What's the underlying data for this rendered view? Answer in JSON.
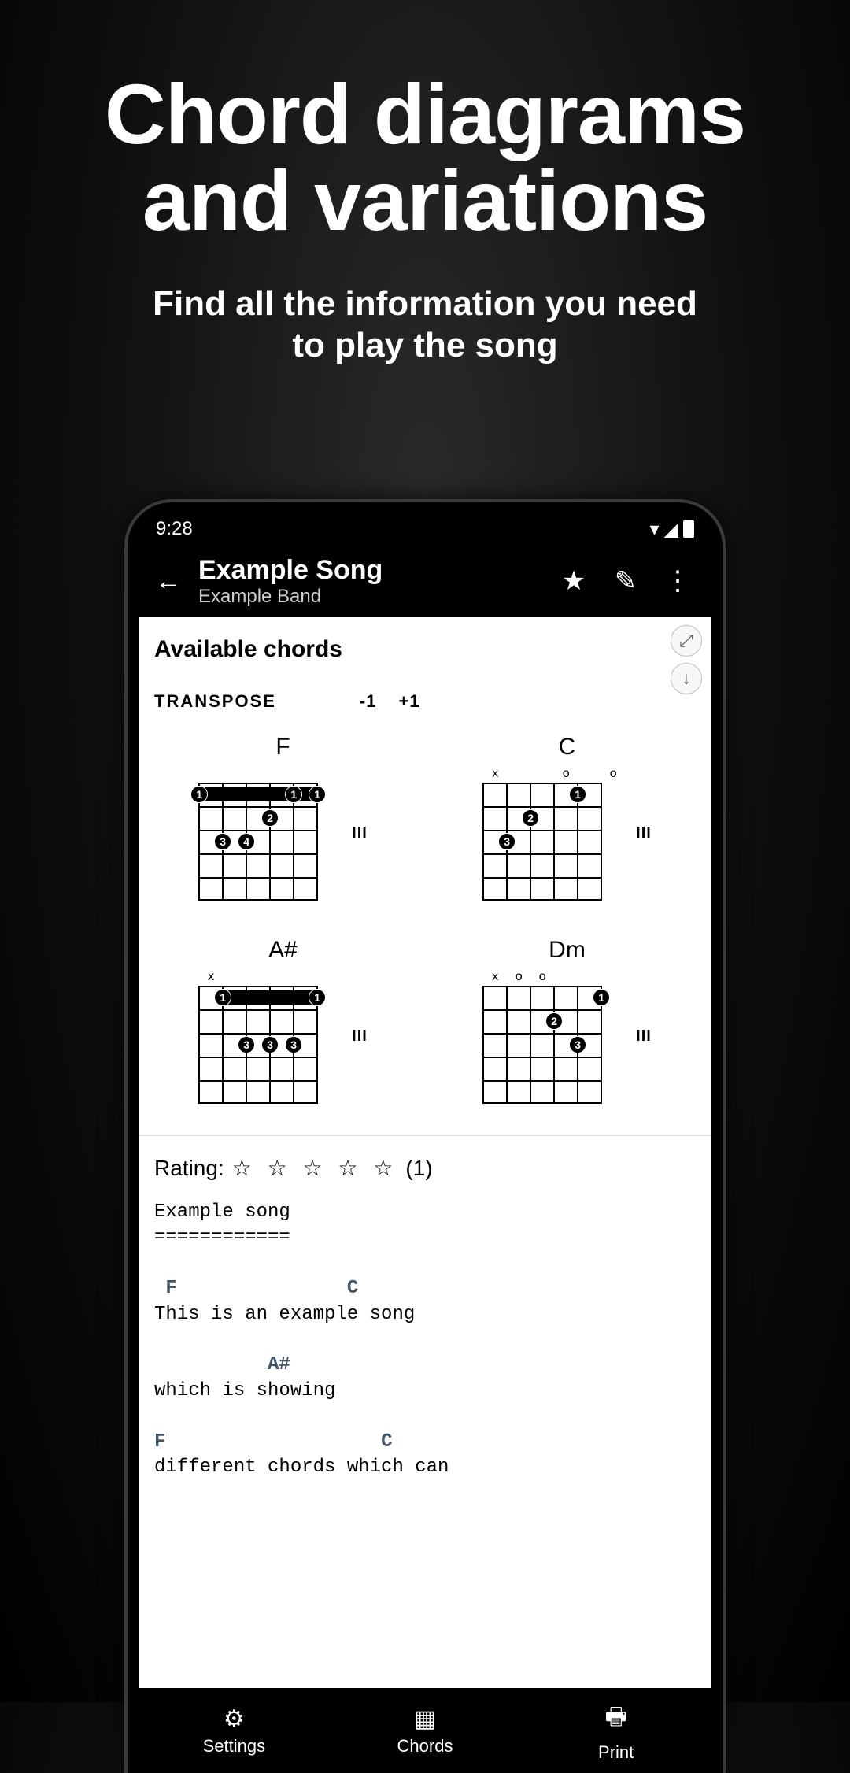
{
  "promo": {
    "title_line1": "Chord diagrams",
    "title_line2": "and variations",
    "subtitle_line1": "Find all the information you need",
    "subtitle_line2": "to play the song"
  },
  "statusbar": {
    "time": "9:28"
  },
  "appbar": {
    "song_title": "Example Song",
    "artist": "Example Band"
  },
  "content": {
    "section_title": "Available chords",
    "transpose_label": "TRANSPOSE",
    "transpose_down": "-1",
    "transpose_up": "+1"
  },
  "chords": {
    "list": [
      {
        "name": "F",
        "position": "III"
      },
      {
        "name": "C",
        "position": "III"
      },
      {
        "name": "A#",
        "position": "III"
      },
      {
        "name": "Dm",
        "position": "III"
      }
    ]
  },
  "rating": {
    "label": "Rating:",
    "count": "(1)"
  },
  "lyrics": {
    "heading": "Example song",
    "underline": "============",
    "line1_chords": {
      "c1": "F",
      "c2": "C"
    },
    "line1_text": "This is an example song",
    "line2_chords": {
      "c1": "A#"
    },
    "line2_text": "which is showing",
    "line3_chords": {
      "c1": "F",
      "c2": "C"
    },
    "line3_text": "different chords which can"
  },
  "bottombar": {
    "settings": "Settings",
    "chords": "Chords",
    "print": "Print"
  }
}
